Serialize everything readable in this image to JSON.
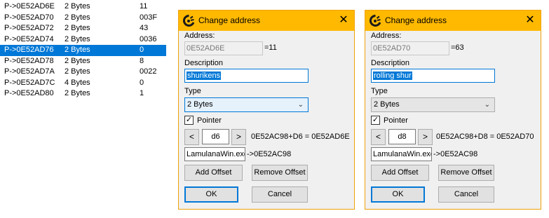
{
  "address_list": [
    {
      "desc": "P->0E52AD6E",
      "type": "2 Bytes",
      "value": "11"
    },
    {
      "desc": "P->0E52AD70",
      "type": "2 Bytes",
      "value": "003F"
    },
    {
      "desc": "P->0E52AD72",
      "type": "2 Bytes",
      "value": "43"
    },
    {
      "desc": "P->0E52AD74",
      "type": "2 Bytes",
      "value": "0036"
    },
    {
      "desc": "P->0E52AD76",
      "type": "2 Bytes",
      "value": "0",
      "selected": true
    },
    {
      "desc": "P->0E52AD78",
      "type": "2 Bytes",
      "value": "8"
    },
    {
      "desc": "P->0E52AD7A",
      "type": "2 Bytes",
      "value": "0022"
    },
    {
      "desc": "P->0E52AD7C",
      "type": "4 Bytes",
      "value": "0"
    },
    {
      "desc": "P->0E52AD80",
      "type": "2 Bytes",
      "value": "1"
    }
  ],
  "dialogs": [
    {
      "title": "Change address",
      "close": "✕",
      "address_label": "Address:",
      "address_value": "0E52AD6E",
      "address_result": "=11",
      "description_label": "Description",
      "description_value": "shurikens",
      "type_label": "Type",
      "type_value": "2 Bytes",
      "pointer_label": "Pointer",
      "pointer_checked": "✓",
      "offset_dec": "<",
      "offset_value": "d6",
      "offset_inc": ">",
      "offset_expr": "0E52AC98+D6 = 0E52AD6E",
      "base_value": "LamulanaWin.exe",
      "base_result": "->0E52AC98",
      "add_offset": "Add Offset",
      "remove_offset": "Remove Offset",
      "ok": "OK",
      "cancel": "Cancel"
    },
    {
      "title": "Change address",
      "close": "✕",
      "address_label": "Address:",
      "address_value": "0E52AD70",
      "address_result": "=63",
      "description_label": "Description",
      "description_value": "rolling shur",
      "type_label": "Type",
      "type_value": "2 Bytes",
      "pointer_label": "Pointer",
      "pointer_checked": "✓",
      "offset_dec": "<",
      "offset_value": "d8",
      "offset_inc": ">",
      "offset_expr": "0E52AC98+D8 = 0E52AD70",
      "base_value": "LamulanaWin.exe",
      "base_result": "->0E52AC98",
      "add_offset": "Add Offset",
      "remove_offset": "Remove Offset",
      "ok": "OK",
      "cancel": "Cancel"
    }
  ],
  "colors": {
    "titlebar": "#ffb900",
    "selection": "#0078d7"
  },
  "icons": {
    "app": "cheat-engine-icon",
    "close": "close-icon",
    "check": "checkmark-icon",
    "dropdown": "chevron-down-icon"
  }
}
